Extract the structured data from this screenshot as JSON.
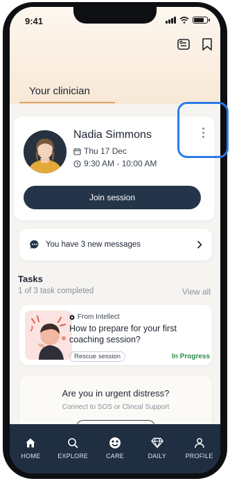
{
  "status_bar": {
    "time": "9:41"
  },
  "header": {
    "section_tab": "Your clinician"
  },
  "clinician": {
    "name": "Nadia Simmons",
    "date": "Thu 17 Dec",
    "time": "9:30 AM - 10:00 AM",
    "join_label": "Join session"
  },
  "messages": {
    "text": "You have 3 new messages"
  },
  "tasks": {
    "title": "Tasks",
    "progress": "1 of 3 task completed",
    "view_all": "View all",
    "items": [
      {
        "source": "From Intellect",
        "title": "How to prepare for your first coaching session?",
        "tag": "Rescue session",
        "status": "In Progress"
      }
    ]
  },
  "urgent": {
    "title": "Are you in urgent distress?",
    "subtitle": "Connect to SOS or Clincal Support"
  },
  "nav": {
    "items": [
      {
        "label": "HOME",
        "icon": "home-icon"
      },
      {
        "label": "EXPLORE",
        "icon": "search-icon"
      },
      {
        "label": "CARE",
        "icon": "care-icon"
      },
      {
        "label": "DAILY",
        "icon": "diamond-icon"
      },
      {
        "label": "PROFILE",
        "icon": "profile-icon"
      }
    ]
  },
  "colors": {
    "primary": "#253549",
    "nav_bg": "#1f2e40",
    "accent_tab": "#d9a35f",
    "status_green": "#2e8b4a",
    "highlight": "#2b7be9"
  }
}
